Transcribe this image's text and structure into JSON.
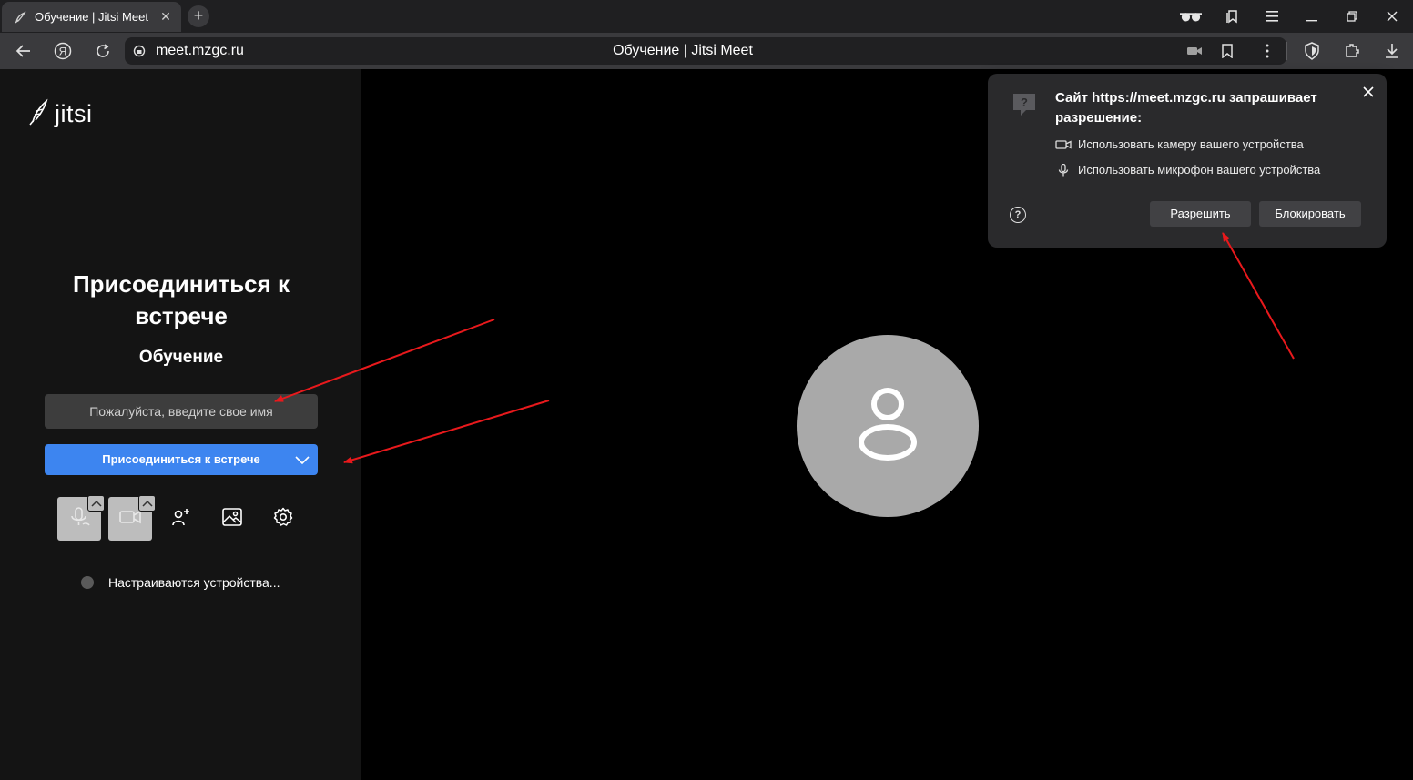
{
  "browser": {
    "tab": {
      "title": "Обучение | Jitsi Meet",
      "favicon": "jitsi-favicon"
    },
    "address": {
      "url": "meet.mzgc.ru",
      "page_title": "Обучение | Jitsi Meet"
    }
  },
  "jitsi": {
    "logo_text": "jitsi",
    "heading": "Присоединиться к встрече",
    "room_name": "Обучение",
    "name_input_placeholder": "Пожалуйста, введите свое имя",
    "join_button": "Присоединиться к встрече",
    "status_text": "Настраиваются устройства..."
  },
  "permission_popup": {
    "title": "Сайт https://meet.mzgc.ru запрашивает разрешение:",
    "camera_text": "Использовать камеру вашего устройства",
    "microphone_text": "Использовать микрофон вашего устройства",
    "allow_button": "Разрешить",
    "block_button": "Блокировать"
  },
  "colors": {
    "accent_blue": "#3d85f0",
    "annotation_arrow": "#e8191c",
    "left_panel_bg": "#141414",
    "avatar_bg": "#a9a9a9"
  }
}
